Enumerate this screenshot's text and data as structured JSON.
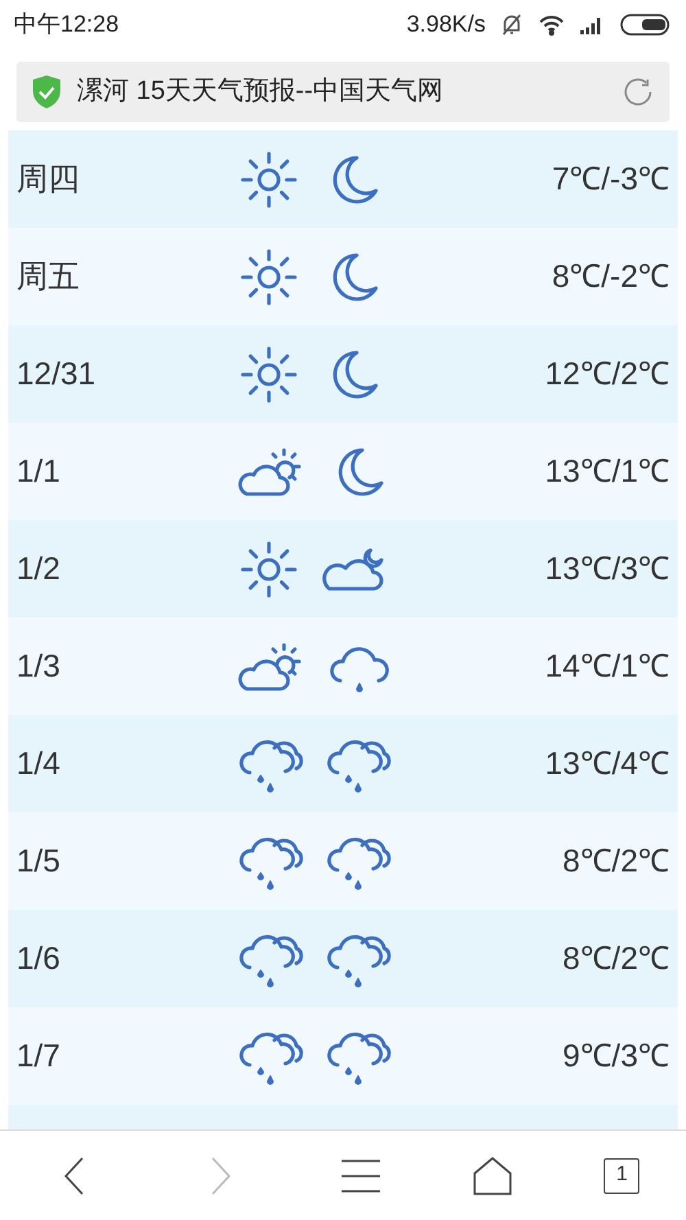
{
  "status_bar": {
    "time": "中午12:28",
    "speed": "3.98K/s"
  },
  "address_bar": {
    "title": "漯河 15天天气预报--中国天气网"
  },
  "days": [
    {
      "date": "周四",
      "icons": [
        {
          "kind": "sun"
        },
        {
          "kind": "moon"
        }
      ],
      "temp": "7℃/-3℃"
    },
    {
      "date": "周五",
      "icons": [
        {
          "kind": "sun"
        },
        {
          "kind": "moon"
        }
      ],
      "temp": "8℃/-2℃"
    },
    {
      "date": "12/31",
      "icons": [
        {
          "kind": "sun"
        },
        {
          "kind": "moon"
        }
      ],
      "temp": "12℃/2℃"
    },
    {
      "date": "1/1",
      "icons": [
        {
          "kind": "cloudsun"
        },
        {
          "kind": "moon"
        }
      ],
      "temp": "13℃/1℃"
    },
    {
      "date": "1/2",
      "icons": [
        {
          "kind": "sun"
        },
        {
          "kind": "cloudmoon"
        }
      ],
      "temp": "13℃/3℃"
    },
    {
      "date": "1/3",
      "icons": [
        {
          "kind": "cloudsun"
        },
        {
          "kind": "drizzle"
        }
      ],
      "temp": "14℃/1℃"
    },
    {
      "date": "1/4",
      "icons": [
        {
          "kind": "rain"
        },
        {
          "kind": "rain"
        }
      ],
      "temp": "13℃/4℃"
    },
    {
      "date": "1/5",
      "icons": [
        {
          "kind": "rain"
        },
        {
          "kind": "rain"
        }
      ],
      "temp": "8℃/2℃"
    },
    {
      "date": "1/6",
      "icons": [
        {
          "kind": "rain"
        },
        {
          "kind": "rain"
        }
      ],
      "temp": "8℃/2℃"
    },
    {
      "date": "1/7",
      "icons": [
        {
          "kind": "rain"
        },
        {
          "kind": "rain"
        }
      ],
      "temp": "9℃/3℃"
    }
  ],
  "bottom_nav": {
    "back_disabled": false,
    "forward_disabled": true,
    "tab_count": "1"
  }
}
